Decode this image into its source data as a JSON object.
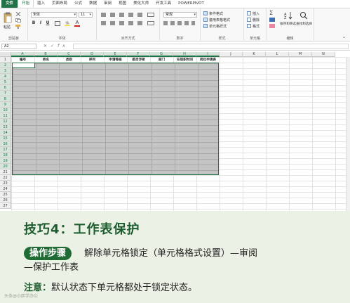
{
  "tabs": [
    "文件",
    "开始",
    "插入",
    "页面布局",
    "公式",
    "数据",
    "审阅",
    "视图",
    "美化大师",
    "开发工具",
    "POWERPIVOT"
  ],
  "ribbon": {
    "clipboard": {
      "paste_label": "粘贴",
      "group_label": "剪贴板"
    },
    "font": {
      "font_name": "宋体",
      "font_size": "11",
      "group_label": "字体"
    },
    "alignment": {
      "group_label": "对齐方式"
    },
    "number": {
      "format": "常规",
      "group_label": "数字"
    },
    "styles": {
      "conditional": "条件格式",
      "table": "套用表格格式",
      "cell_styles": "单元格样式",
      "group_label": "样式"
    },
    "cells": {
      "insert": "插入",
      "delete": "删除",
      "format": "格式",
      "group_label": "单元格"
    },
    "editing": {
      "sort": "排序和筛选",
      "find": "查找和选择",
      "group_label": "编辑"
    }
  },
  "formula_bar": {
    "name_box": "A2",
    "fx": "fx"
  },
  "sheet": {
    "columns": [
      "A",
      "B",
      "C",
      "D",
      "E",
      "F",
      "G",
      "H",
      "I",
      "J",
      "K",
      "L",
      "M",
      "N"
    ],
    "rows": [
      "1",
      "2",
      "3",
      "4",
      "5",
      "6",
      "7",
      "8",
      "9",
      "10",
      "11",
      "12",
      "13",
      "14",
      "15",
      "16",
      "17",
      "18",
      "19",
      "20",
      "21",
      "22",
      "23",
      "24",
      "25",
      "26",
      "27"
    ],
    "headers": [
      "编号",
      "姓名",
      "类别",
      "序列",
      "申请等级",
      "是否涉密",
      "部门",
      "任现职时间",
      "岗位申请表"
    ]
  },
  "panel": {
    "title": "技巧4：工作表保护",
    "step_badge": "操作步骤",
    "step_text": "解除单元格锁定（单元格格式设置）—审阅",
    "step_text2": "—保护工作表",
    "note_label": "注意：",
    "note_text": "默认状态下单元格都处于锁定状态。",
    "watermark": "头条@小胖学办公"
  }
}
